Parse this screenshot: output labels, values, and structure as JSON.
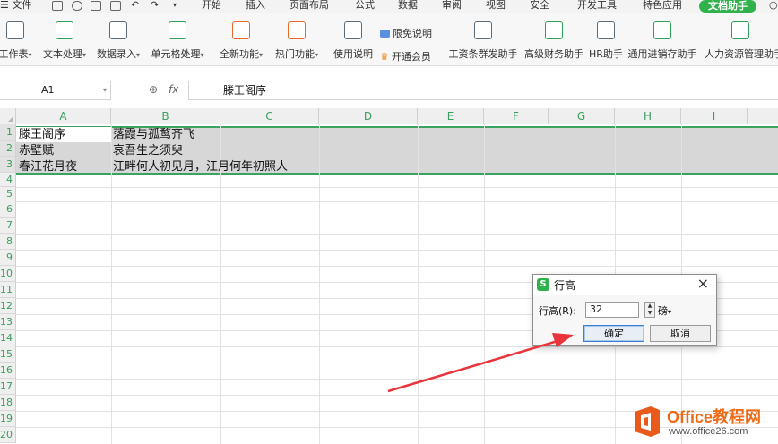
{
  "menubar": {
    "file_label": "文件",
    "tabs": [
      {
        "label": "开始"
      },
      {
        "label": "插入"
      },
      {
        "label": "页面布局"
      },
      {
        "label": "公式"
      },
      {
        "label": "数据"
      },
      {
        "label": "审阅"
      },
      {
        "label": "视图"
      },
      {
        "label": "安全"
      },
      {
        "label": "开发工具"
      },
      {
        "label": "特色应用"
      }
    ],
    "active_tab": "文档助手",
    "accent_color": "#2fb24c"
  },
  "ribbon": {
    "buttons": [
      {
        "label": "工作表",
        "icon": "worksheet-icon"
      },
      {
        "label": "文本处理",
        "icon": "text-process-icon"
      },
      {
        "label": "数据录入",
        "icon": "data-entry-icon"
      },
      {
        "label": "单元格处理",
        "icon": "cell-process-icon"
      },
      {
        "label": "全新功能",
        "icon": "new-feature-icon"
      },
      {
        "label": "热门功能",
        "icon": "hot-feature-icon"
      },
      {
        "label": "使用说明",
        "icon": "help-doc-icon"
      }
    ],
    "limit_label": "限免说明",
    "member_label": "开通会员",
    "assistants": [
      {
        "label": "工资条群发助手"
      },
      {
        "label": "高级财务助手"
      },
      {
        "label": "HR助手"
      },
      {
        "label": "通用进销存助手"
      },
      {
        "label": "人力资源管理助手"
      }
    ]
  },
  "formula_bar": {
    "cell_ref": "A1",
    "fx_label": "fx",
    "content": "滕王阁序"
  },
  "sheet": {
    "columns": [
      "A",
      "B",
      "C",
      "D",
      "E",
      "F",
      "G",
      "H",
      "I"
    ],
    "rows": [
      "1",
      "2",
      "3",
      "4",
      "5",
      "6",
      "7",
      "8",
      "9",
      "10",
      "11",
      "12",
      "13",
      "14",
      "15",
      "16",
      "17",
      "18",
      "19",
      "20"
    ],
    "cells": {
      "A1": "滕王阁序",
      "B1": "落霞与孤鹜齐飞",
      "A2": "赤壁赋",
      "B2": "哀吾生之须臾",
      "A3": "春江花月夜",
      "B3": "江畔何人初见月，江月何年初照人"
    },
    "selection_color": "#3aa35d"
  },
  "dialog": {
    "title": "行高",
    "field_label": "行高(R):",
    "value": "32",
    "unit": "磅",
    "ok_label": "确定",
    "cancel_label": "取消"
  },
  "watermark": {
    "brand": "Office教程网",
    "url": "www.office26.com"
  }
}
